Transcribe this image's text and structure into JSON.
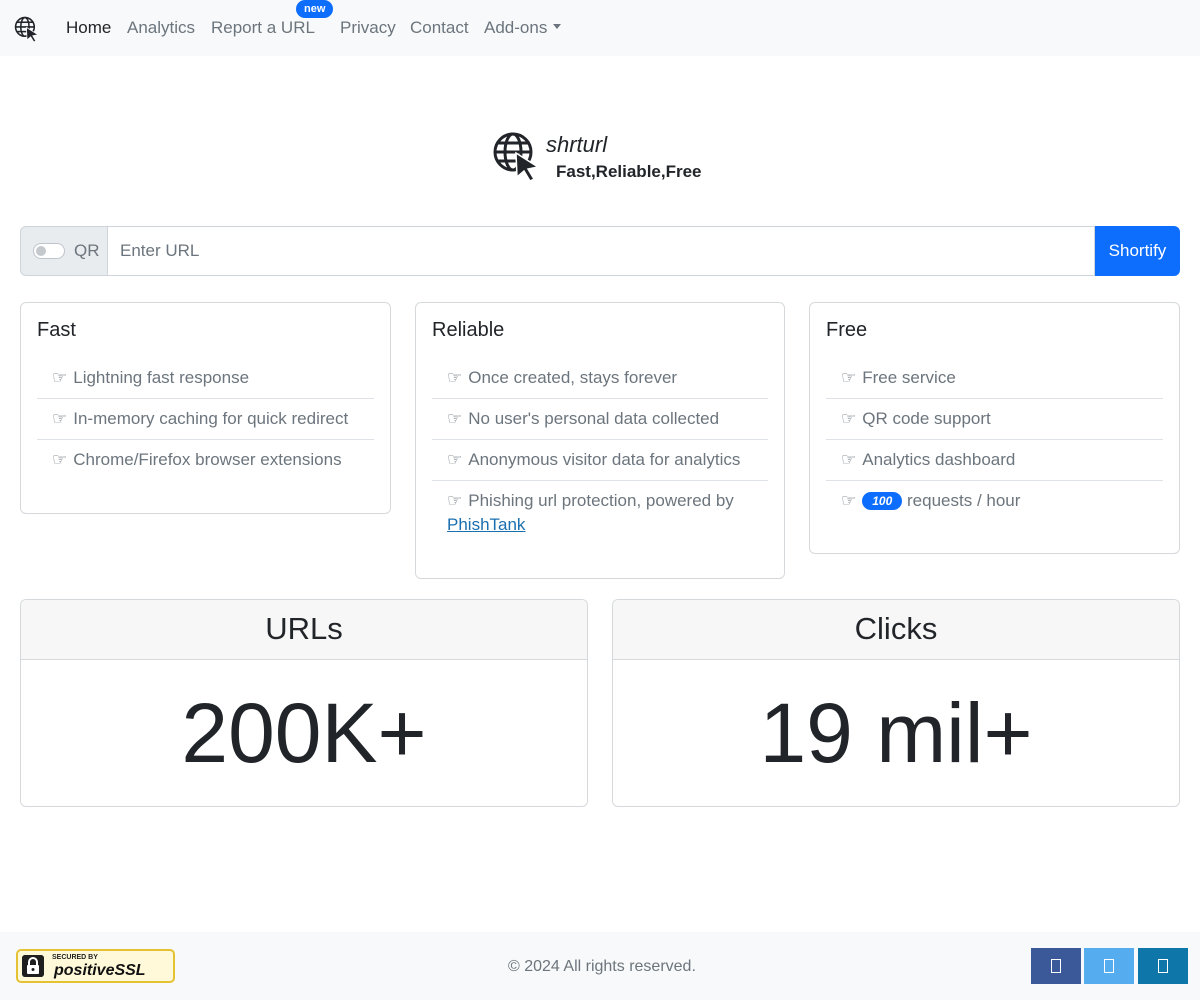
{
  "nav": {
    "items": [
      "Home",
      "Analytics",
      "Report a URL",
      "Privacy",
      "Contact",
      "Add-ons"
    ],
    "badge": "new"
  },
  "brand": {
    "name": "shrturl",
    "tagline": "Fast,Reliable,Free"
  },
  "form": {
    "qr_label": "QR",
    "qr_enabled": false,
    "url_placeholder": "Enter URL",
    "url_value": "",
    "submit_label": "Shortify"
  },
  "cards": [
    {
      "title": "Fast",
      "items": [
        "Lightning fast response",
        "In-memory caching for quick redirect",
        "Chrome/Firefox browser extensions"
      ]
    },
    {
      "title": "Reliable",
      "items": [
        "Once created, stays forever",
        "No user's personal data collected",
        "Anonymous visitor data for analytics",
        "Phishing url protection, powered by"
      ],
      "link": "PhishTank"
    },
    {
      "title": "Free",
      "items": [
        "Free service",
        "QR code support",
        "Analytics dashboard",
        "requests / hour"
      ],
      "rate_badge": "100"
    }
  ],
  "stats": [
    {
      "label": "URLs",
      "value": "200K+"
    },
    {
      "label": "Clicks",
      "value": "19 mil+"
    }
  ],
  "footer": {
    "ssl_small": "SECURED BY",
    "ssl_brand": "positiveSSL",
    "copyright": "© 2024 All rights reserved.",
    "social_colors": [
      "#3b5998",
      "#55acee",
      "#0e76a8"
    ]
  },
  "icons": {
    "logo": "globe-cursor-icon",
    "list_bullet": "pointing-hand-icon",
    "social": [
      "facebook-icon",
      "twitter-icon",
      "linkedin-icon"
    ]
  },
  "colors": {
    "primary": "#0d6efd",
    "navbar_bg": "#f8f9fa"
  }
}
